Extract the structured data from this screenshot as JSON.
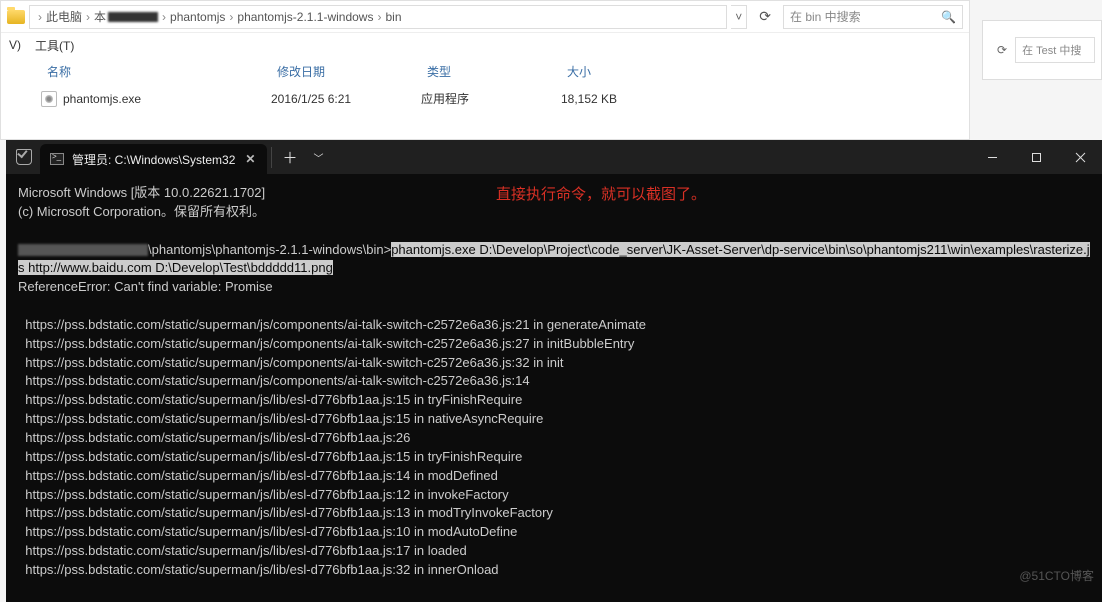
{
  "bg_explorer": {
    "search_placeholder": "在 Test 中搜"
  },
  "explorer": {
    "breadcrumbs": [
      "此电脑",
      "本",
      "phantomjs",
      "phantomjs-2.1.1-windows",
      "bin"
    ],
    "search_placeholder": "在 bin 中搜索",
    "menu": {
      "view": "V)",
      "tools": "工具(T)"
    },
    "cols": {
      "name": "名称",
      "date": "修改日期",
      "type": "类型",
      "size": "大小"
    },
    "row": {
      "name": "phantomjs.exe",
      "date": "2016/1/25 6:21",
      "type": "应用程序",
      "size": "18,152 KB"
    }
  },
  "terminal": {
    "tab_title": "管理员: C:\\Windows\\System32",
    "annotation": "直接执行命令，就可以截图了。",
    "banner1": "Microsoft Windows [版本 10.0.22621.1702]",
    "banner2": "(c) Microsoft Corporation。保留所有权利。",
    "prompt_path": "phantomjs\\phantomjs-2.1.1-windows\\bin>",
    "cmd": "phantomjs.exe D:\\Develop\\Project\\code_server\\JK-Asset-Server\\dp-service\\bin\\so\\phantomjs211\\win\\examples\\rasterize.js http://www.baidu.com D:\\Develop\\Test\\bddddd11.png",
    "err": "ReferenceError: Can't find variable: Promise",
    "lines": [
      "  https://pss.bdstatic.com/static/superman/js/components/ai-talk-switch-c2572e6a36.js:21 in generateAnimate",
      "  https://pss.bdstatic.com/static/superman/js/components/ai-talk-switch-c2572e6a36.js:27 in initBubbleEntry",
      "  https://pss.bdstatic.com/static/superman/js/components/ai-talk-switch-c2572e6a36.js:32 in init",
      "  https://pss.bdstatic.com/static/superman/js/components/ai-talk-switch-c2572e6a36.js:14",
      "  https://pss.bdstatic.com/static/superman/js/lib/esl-d776bfb1aa.js:15 in tryFinishRequire",
      "  https://pss.bdstatic.com/static/superman/js/lib/esl-d776bfb1aa.js:15 in nativeAsyncRequire",
      "  https://pss.bdstatic.com/static/superman/js/lib/esl-d776bfb1aa.js:26",
      "  https://pss.bdstatic.com/static/superman/js/lib/esl-d776bfb1aa.js:15 in tryFinishRequire",
      "  https://pss.bdstatic.com/static/superman/js/lib/esl-d776bfb1aa.js:14 in modDefined",
      "  https://pss.bdstatic.com/static/superman/js/lib/esl-d776bfb1aa.js:12 in invokeFactory",
      "  https://pss.bdstatic.com/static/superman/js/lib/esl-d776bfb1aa.js:13 in modTryInvokeFactory",
      "  https://pss.bdstatic.com/static/superman/js/lib/esl-d776bfb1aa.js:10 in modAutoDefine",
      "  https://pss.bdstatic.com/static/superman/js/lib/esl-d776bfb1aa.js:17 in loaded",
      "  https://pss.bdstatic.com/static/superman/js/lib/esl-d776bfb1aa.js:32 in innerOnload"
    ],
    "watermark": "@51CTO博客"
  }
}
